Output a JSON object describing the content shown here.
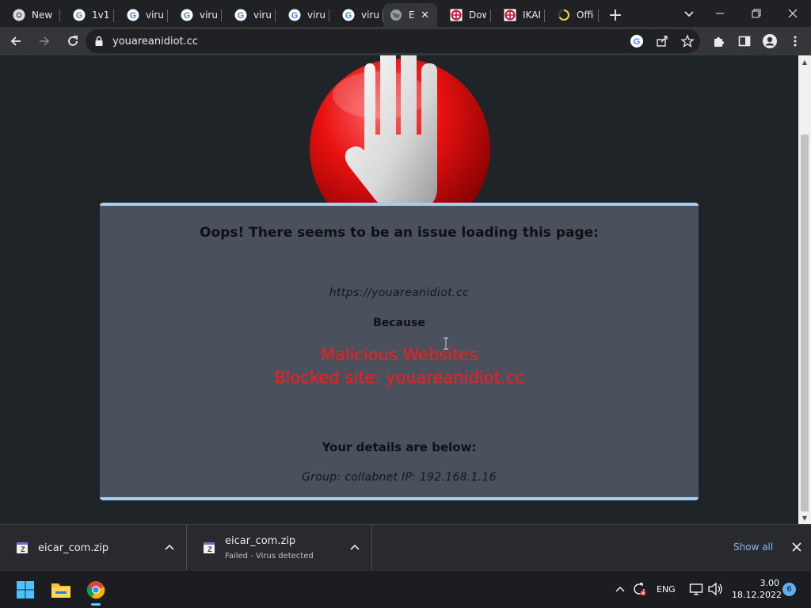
{
  "browser": {
    "tabs": [
      {
        "title": "New",
        "favicon": "chrome-icon",
        "active": false
      },
      {
        "title": "1v1 -",
        "favicon": "google-icon",
        "active": false
      },
      {
        "title": "virus",
        "favicon": "google-icon",
        "active": false
      },
      {
        "title": "virus",
        "favicon": "google-icon",
        "active": false
      },
      {
        "title": "virus",
        "favicon": "google-icon",
        "active": false
      },
      {
        "title": "virus",
        "favicon": "google-icon",
        "active": false
      },
      {
        "title": "virus",
        "favicon": "google-icon",
        "active": false
      },
      {
        "title": "E",
        "favicon": "globe-icon",
        "active": true
      },
      {
        "title": "Dow",
        "favicon": "ikarus-icon",
        "active": false
      },
      {
        "title": "IKAR",
        "favicon": "ikarus-icon",
        "active": false
      },
      {
        "title": "Offic",
        "favicon": "loading-spinner-icon",
        "active": false
      }
    ],
    "new_tab_label": "+",
    "address_bar": {
      "url": "youareanidiot.cc"
    }
  },
  "page": {
    "heading": "Oops! There seems to be an issue loading this page:",
    "blocked_url": "https://youareanidiot.cc",
    "because_label": "Because",
    "reason_category": "Malicious Websites",
    "reason_detail": "Blocked site: youareanidiot.cc",
    "details_heading": "Your details are below:",
    "details_line": "Group: collabnet   IP: 192.168.1.16"
  },
  "downloads": {
    "items": [
      {
        "filename": "eicar_com.zip",
        "status": ""
      },
      {
        "filename": "eicar_com.zip",
        "status": "Failed - Virus detected"
      }
    ],
    "show_all_label": "Show all"
  },
  "taskbar": {
    "language": "ENG",
    "time": "3.00",
    "date": "18.12.2022",
    "notification_count": "6"
  },
  "colors": {
    "panel_bg": "#4a505c",
    "panel_border": "#9fcff5",
    "reason_red": "#ff1a1a",
    "page_bg": "#1f2429",
    "link_blue": "#8ab4f8"
  }
}
